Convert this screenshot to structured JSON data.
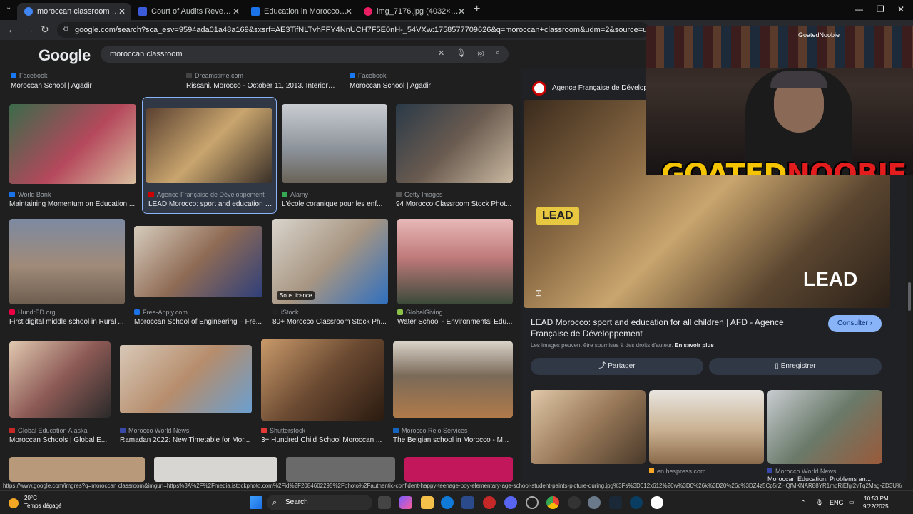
{
  "browser": {
    "tabs": [
      {
        "title": "moroccan classroom - Recherche",
        "active": true,
        "color": "#4285f4"
      },
      {
        "title": "Court of Audits Reveals Dark Re",
        "active": false,
        "color": "#3b5bdb"
      },
      {
        "title": "Education in Morocco, between",
        "active": false,
        "color": "#1a73e8"
      },
      {
        "title": "img_7176.jpg (4032×3024)",
        "active": false,
        "color": "#e91e63"
      }
    ],
    "url": "google.com/search?sca_esv=9594ada01a48a169&sxsrf=AE3TifNLTvhFFY4NnUCH7F5E0nH-_54VXw:1758577709626&q=moroccan+classroom&udm=2&source=univ&fir=QbgmGXKG6_P1M%252"
  },
  "google": {
    "logo": "Google",
    "query": "moroccan classroom"
  },
  "top_row": [
    {
      "source": "Facebook",
      "caption": "Moroccan School | Agadir"
    },
    {
      "source": "Dreamstime.com",
      "caption": "Rissani, Morocco - October 11, 2013. Interior o..."
    },
    {
      "source": "Facebook",
      "caption": "Moroccan School | Agadir"
    }
  ],
  "results": [
    {
      "source": "World Bank",
      "caption": "Maintaining Momentum on Education ...",
      "color": "#b5485c"
    },
    {
      "source": "Agence Française de Développement",
      "caption": "LEAD Morocco: sport and education f...",
      "color": "#7b6b4a"
    },
    {
      "source": "Alamy",
      "caption": "L'école coranique pour les enf...",
      "color": "#8a9098"
    },
    {
      "source": "Getty Images",
      "caption": "94 Morocco Classroom Stock Phot...",
      "color": "#6a5b50"
    },
    {
      "source": "HundrED.org",
      "caption": "First digital middle school in Rural ...",
      "color": "#7d8aa2"
    },
    {
      "source": "Free-Apply.com",
      "caption": "Moroccan School of Engineering – Fre...",
      "color": "#8f6b55"
    },
    {
      "source": "iStock",
      "caption": "80+ Morocco Classroom Stock Ph...",
      "color": "#a89682",
      "license": "Sous licence"
    },
    {
      "source": "GlobalGiving",
      "caption": "Water School - Environmental Edu...",
      "color": "#c07a7a"
    },
    {
      "source": "Global Education Alaska",
      "caption": "Moroccan Schools | Global E...",
      "color": "#8e5b56"
    },
    {
      "source": "Morocco World News",
      "caption": "Ramadan 2022: New Timetable for Mor...",
      "color": "#b68d6c"
    },
    {
      "source": "Shutterstock",
      "caption": "3+ Hundred Child School Moroccan ...",
      "color": "#6b4a32"
    },
    {
      "source": "Morocco Relo Services",
      "caption": "The Belgian school in Morocco - M...",
      "color": "#7a6a58"
    }
  ],
  "panel": {
    "source": "Agence Française de Développement",
    "title": "LEAD Morocco: sport and education for all children | AFD - Agence Française de Développement",
    "consult": "Consulter",
    "note": "Les images peuvent être soumises à des droits d'auteur.",
    "learn_more": "En savoir plus",
    "share": "Partager",
    "save": "Enregistrer",
    "image_text": "LEAD",
    "related": [
      {
        "source": "",
        "caption": ""
      },
      {
        "source": "en.hespress.com",
        "caption": ""
      },
      {
        "source": "Morocco World News",
        "caption": "Moroccan Education: Problems an..."
      }
    ]
  },
  "webcam": {
    "handle": "GoatedNoobie",
    "brand_a": "GOATED",
    "brand_b": "NOOBIE"
  },
  "status_url": "https://www.google.com/imgres?q=moroccan classroom&imgurl=https%3A%2F%2Fmedia.istockphoto.com%2Fid%2F2084602295%2Fphoto%2Fauthentic-confident-happy-teenage-boy-elementary-age-school-student-paints-picture-during.jpg%3Fs%3D612x612%26w%3D0%26k%3D20%26c%3DZ4z5Cp5rZHQfMKNAR88YR1mpRiEfgl2vTq2Mag-ZD3U%",
  "taskbar": {
    "temp": "20°C",
    "weather": "Temps dégagé",
    "search": "Search",
    "lang": "ENG",
    "time": "10:53 PM",
    "date": "9/22/2025"
  }
}
